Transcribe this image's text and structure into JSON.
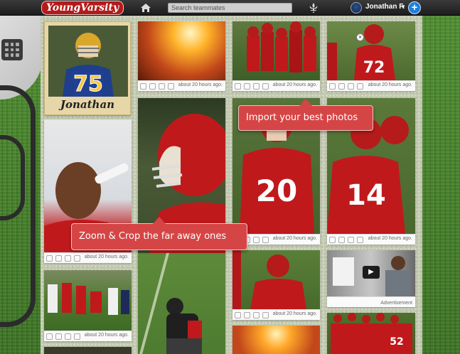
{
  "topbar": {
    "logo": "YoungVarsity",
    "search_placeholder": "Search teammates",
    "user_name": "Jonathan F.",
    "caret": "▼",
    "add_label": "+"
  },
  "profile": {
    "name": "Jonathan",
    "jersey_number": "75"
  },
  "feed": {
    "timestamp": "about 20 hours ago.",
    "close_label": "×",
    "ad_label": "Advertisement",
    "play_label": "▶"
  },
  "tooltips": {
    "import": "Import your best photos",
    "zoom": "Zoom & Crop the far away ones"
  },
  "jerseys": {
    "a": "72",
    "b": "20",
    "c": "14",
    "d": "52"
  },
  "colors": {
    "team_red": "#c0191c",
    "tooltip_red": "#d64545",
    "accent_blue": "#1d7fe0"
  }
}
